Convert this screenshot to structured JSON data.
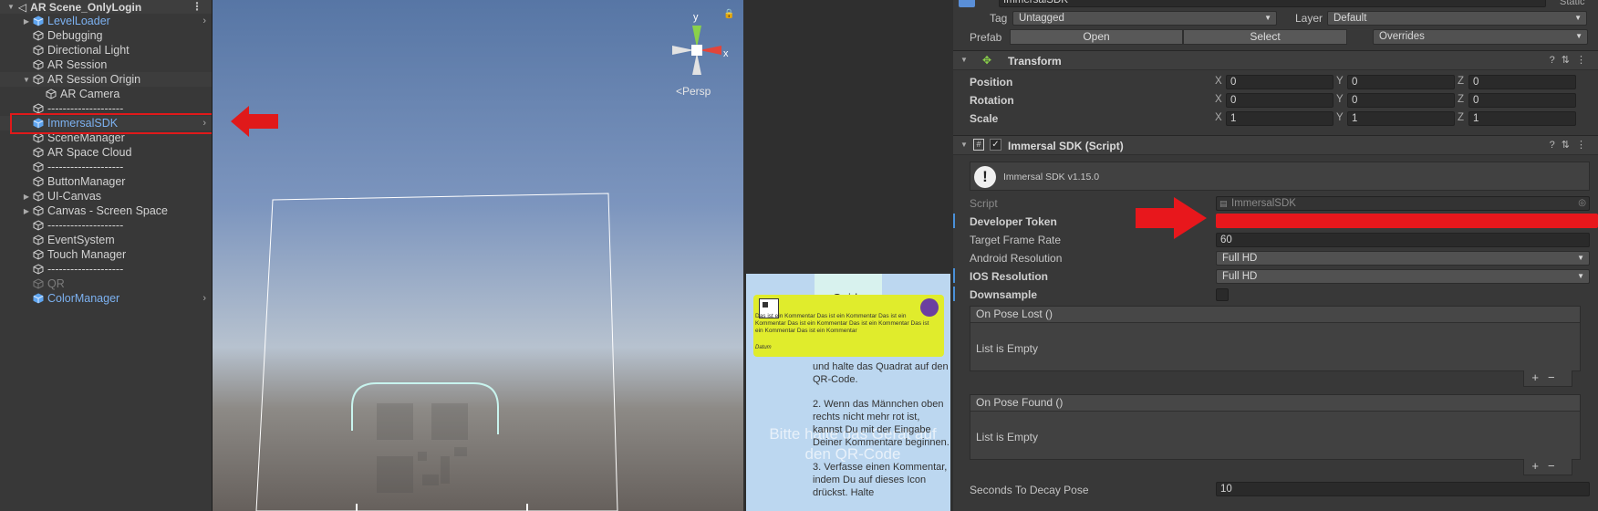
{
  "hierarchy": {
    "scene_name": "AR Scene_OnlyLogin",
    "items": [
      {
        "label": "LevelLoader",
        "kind": "prefab",
        "foldout": true,
        "chevron": true
      },
      {
        "label": "Debugging",
        "kind": "object"
      },
      {
        "label": "Directional Light",
        "kind": "object"
      },
      {
        "label": "AR Session",
        "kind": "object"
      },
      {
        "label": "AR Session Origin",
        "kind": "object",
        "foldout": true,
        "expanded": true
      },
      {
        "label": "AR Camera",
        "kind": "object",
        "child": true
      },
      {
        "label": "--------------------",
        "kind": "object"
      },
      {
        "label": "ImmersalSDK",
        "kind": "prefab",
        "chevron": true,
        "selected": true
      },
      {
        "label": "SceneManager",
        "kind": "object"
      },
      {
        "label": "AR Space Cloud",
        "kind": "object"
      },
      {
        "label": "--------------------",
        "kind": "object"
      },
      {
        "label": "ButtonManager",
        "kind": "object"
      },
      {
        "label": "UI-Canvas",
        "kind": "object",
        "foldout": true
      },
      {
        "label": "Canvas - Screen Space",
        "kind": "object",
        "foldout": true
      },
      {
        "label": "--------------------",
        "kind": "object"
      },
      {
        "label": "EventSystem",
        "kind": "object"
      },
      {
        "label": "Touch Manager",
        "kind": "object"
      },
      {
        "label": "--------------------",
        "kind": "object"
      },
      {
        "label": "QR",
        "kind": "disabled"
      },
      {
        "label": "ColorManager",
        "kind": "prefab",
        "chevron": true
      }
    ]
  },
  "scene_view": {
    "projection_label": "<Persp",
    "gizmo_axes": {
      "y": "y",
      "x": "x"
    }
  },
  "game_view": {
    "guide_tab": "Guide",
    "note_text": "Das ist ein Kommentar Das ist ein Kommentar Das ist ein Kommentar Das ist ein Kommentar Das ist ein Kommentar Das ist ein Kommentar Das ist ein Kommentar",
    "note_date": "Datum",
    "guide_steps": [
      "und halte das Quadrat auf den QR-Code.",
      "2. Wenn das Männchen oben rechts nicht mehr rot ist, kannst Du mit der Eingabe Deiner Kommentare beginnen.",
      "3. Verfasse einen Kommentar, indem Du auf dieses Icon drückst. Halte"
    ],
    "ghost_text": "Bitte halte das Gerät auf den QR-Code"
  },
  "inspector": {
    "object_name": "ImmersalSDK",
    "static_label": "Static",
    "tag_label": "Tag",
    "tag_value": "Untagged",
    "layer_label": "Layer",
    "layer_value": "Default",
    "prefab_label": "Prefab",
    "open_button": "Open",
    "select_button": "Select",
    "overrides_dropdown": "Overrides",
    "transform": {
      "title": "Transform",
      "rows": [
        {
          "label": "Position",
          "x": "0",
          "y": "0",
          "z": "0"
        },
        {
          "label": "Rotation",
          "x": "0",
          "y": "0",
          "z": "0"
        },
        {
          "label": "Scale",
          "x": "1",
          "y": "1",
          "z": "1"
        }
      ]
    },
    "script_component": {
      "title": "Immersal SDK (Script)",
      "version": "Immersal SDK v1.15.0",
      "script_label": "Script",
      "script_value": "ImmersalSDK",
      "developer_token_label": "Developer Token",
      "developer_token_value": "",
      "redact_color": "#e8171c",
      "target_frame_rate_label": "Target Frame Rate",
      "target_frame_rate_value": "60",
      "android_resolution_label": "Android Resolution",
      "android_resolution_value": "Full HD",
      "ios_resolution_label": "IOS Resolution",
      "ios_resolution_value": "Full HD",
      "downsample_label": "Downsample",
      "on_pose_lost_label": "On Pose Lost ()",
      "on_pose_lost_empty": "List is Empty",
      "on_pose_found_label": "On Pose Found ()",
      "on_pose_found_empty": "List is Empty",
      "seconds_to_decay_label": "Seconds To Decay Pose",
      "seconds_to_decay_value": "10"
    }
  },
  "colors": {
    "annotation_red": "#e0191a",
    "prefab_blue": "#7cb1f0",
    "panel_bg": "#383838"
  }
}
